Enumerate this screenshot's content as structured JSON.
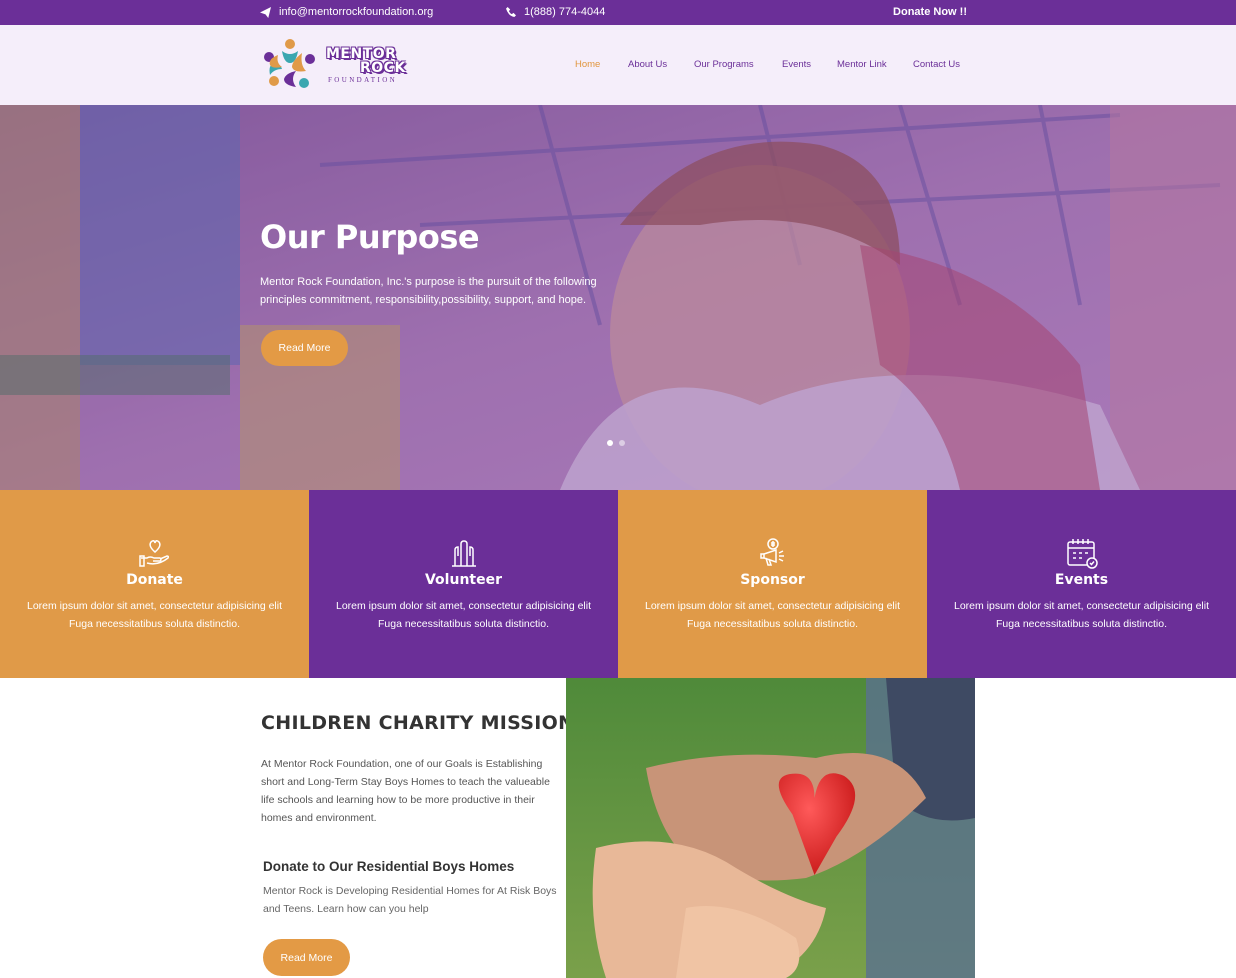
{
  "topbar": {
    "email": "info@mentorrockfoundation.org",
    "phone": "1(888) 774-4044",
    "donate": "Donate Now !!"
  },
  "logo": {
    "word1": "MENTOR",
    "word2": "ROCK",
    "sub": "FOUNDATION"
  },
  "nav": {
    "items": [
      {
        "label": "Home"
      },
      {
        "label": "About Us"
      },
      {
        "label": "Our Programs"
      },
      {
        "label": "Events"
      },
      {
        "label": "Mentor Link"
      },
      {
        "label": "Contact Us"
      }
    ]
  },
  "hero": {
    "title": "Our Purpose",
    "text": "Mentor Rock Foundation, Inc.'s purpose is the pursuit of the following principles commitment, responsibility,possibility, support, and hope.",
    "button": "Read More"
  },
  "features": [
    {
      "title": "Donate",
      "text": "Lorem ipsum dolor sit amet, consectetur adipisicing elit Fuga necessitatibus soluta distinctio."
    },
    {
      "title": "Volunteer",
      "text": "Lorem ipsum dolor sit amet, consectetur adipisicing elit Fuga necessitatibus soluta distinctio."
    },
    {
      "title": "Sponsor",
      "text": "Lorem ipsum dolor sit amet, consectetur adipisicing elit Fuga necessitatibus soluta distinctio."
    },
    {
      "title": "Events",
      "text": "Lorem ipsum dolor sit amet, consectetur adipisicing elit Fuga necessitatibus soluta distinctio."
    }
  ],
  "mission": {
    "title": "CHILDREN CHARITY MISSION",
    "text": "At Mentor Rock Foundation, one of our Goals is Establishing short and Long-Term Stay Boys Homes to teach the valueable life schools and learning how to be more productive in their homes and environment.",
    "donate_title": "Donate to Our Residential Boys Homes",
    "donate_text": "Mentor Rock is Developing Residential Homes for At Risk Boys and Teens. Learn how can you help",
    "button": "Read More"
  },
  "colors": {
    "purple": "#6b2f98",
    "orange": "#e09a48",
    "header_bg": "#f5eefa"
  }
}
